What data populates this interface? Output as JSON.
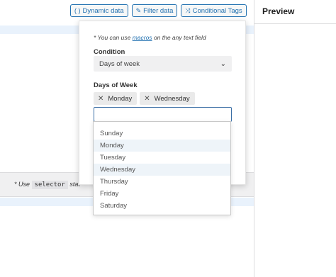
{
  "toolbar": {
    "dynamic_data": "Dynamic data",
    "dynamic_icon": "( )",
    "filter_data": "Filter data",
    "filter_icon": "✎",
    "conditional_tags": "Conditional Tags",
    "conditional_icon": "⤨"
  },
  "preview": {
    "title": "Preview"
  },
  "popup": {
    "hint_prefix": "* You can use",
    "hint_link": "macros",
    "hint_suffix": "on the any text field",
    "condition_label": "Condition",
    "condition_value": "Days of week",
    "days_label": "Days of Week",
    "chips": [
      "Monday",
      "Wednesday"
    ],
    "search_value": ""
  },
  "dropdown": {
    "options": [
      "Sunday",
      "Monday",
      "Tuesday",
      "Wednesday",
      "Thursday",
      "Friday",
      "Saturday"
    ],
    "selected": [
      "Monday",
      "Wednesday"
    ]
  },
  "note": {
    "prefix": "* Use",
    "code": "selector",
    "suffix": "stat"
  },
  "colors": {
    "accent": "#2271b1",
    "highlight": "#e9f2fc",
    "selected_bg": "#eef4f9"
  }
}
